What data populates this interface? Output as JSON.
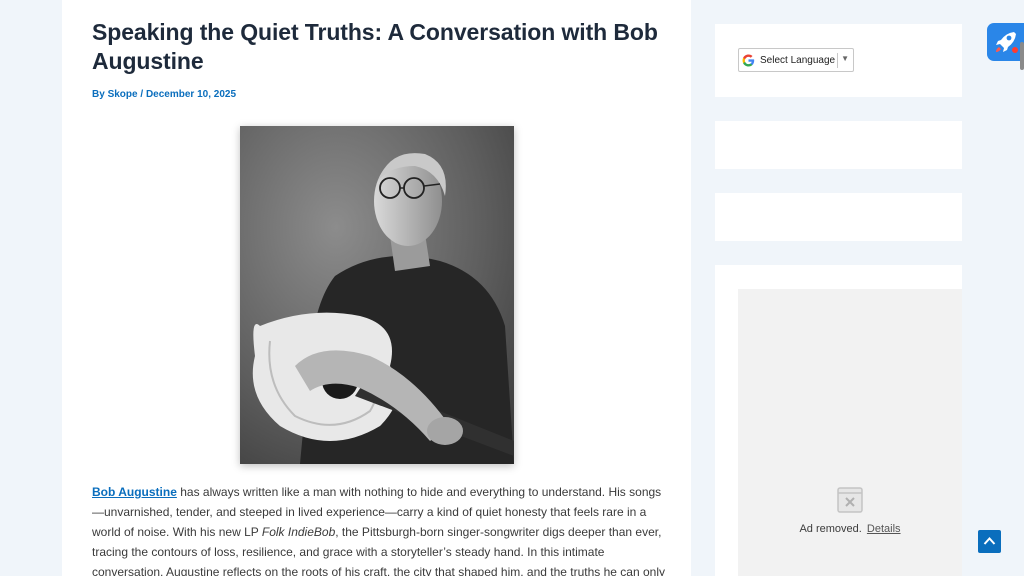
{
  "article": {
    "title": "Speaking the Quiet Truths: A Conversation with Bob Augustine",
    "meta": {
      "by_label": "By",
      "author": "Skope",
      "separator": "/",
      "date": "December 10, 2025"
    },
    "photo_alt": "Black and white portrait of Bob Augustine holding an acoustic guitar",
    "body": {
      "link_text": "Bob Augustine",
      "part1": " has always written like a man with nothing to hide and everything to understand. His songs —unvarnished, tender, and steeped in lived experience—carry a kind of quiet honesty that feels rare in a world of noise. With his new LP ",
      "album": "Folk IndieBob",
      "part2": ", the Pittsburgh-born singer-songwriter digs deeper than ever, tracing the contours of loss, resilience, and grace with a storyteller’s steady hand. In this intimate conversation, Augustine reflects on the roots of his craft, the city that shaped him, and the truths he can only"
    }
  },
  "sidebar": {
    "language_select": {
      "label": "Select Language",
      "caret": "▼",
      "icon": "google-g-icon"
    },
    "ad": {
      "removed_text": "Ad removed.",
      "details_link": "Details",
      "icon": "ad-removed-icon"
    }
  },
  "floating": {
    "rocket_icon": "rocket-icon",
    "scroll_top_icon": "chevron-up-icon"
  },
  "colors": {
    "background": "#f0f5fa",
    "accent": "#0a6ebd",
    "title": "#1e2a3b",
    "rocket": "#2a86e8"
  }
}
